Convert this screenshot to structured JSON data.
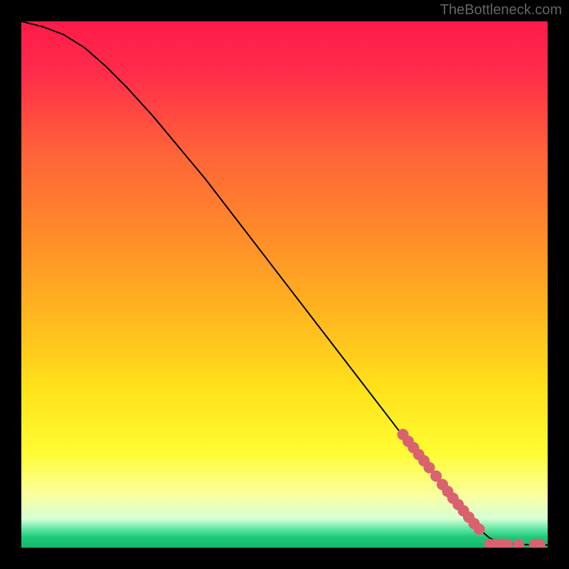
{
  "watermark": "TheBottleneck.com",
  "chart_data": {
    "type": "line",
    "title": "",
    "xlabel": "",
    "ylabel": "",
    "xlim": [
      0,
      100
    ],
    "ylim": [
      0,
      100
    ],
    "gradient_stops": [
      {
        "offset": 0,
        "color": "#ff1a4a"
      },
      {
        "offset": 0.1,
        "color": "#ff2d4a"
      },
      {
        "offset": 0.25,
        "color": "#ff6338"
      },
      {
        "offset": 0.4,
        "color": "#ff8a2a"
      },
      {
        "offset": 0.55,
        "color": "#ffb41f"
      },
      {
        "offset": 0.7,
        "color": "#ffe21a"
      },
      {
        "offset": 0.82,
        "color": "#fffc33"
      },
      {
        "offset": 0.9,
        "color": "#fbffa0"
      },
      {
        "offset": 0.945,
        "color": "#d6ffd6"
      },
      {
        "offset": 0.965,
        "color": "#5de6a3"
      },
      {
        "offset": 0.98,
        "color": "#1ec97a"
      },
      {
        "offset": 1.0,
        "color": "#13b86b"
      }
    ],
    "curve": [
      {
        "x": 0,
        "y": 100
      },
      {
        "x": 4,
        "y": 99
      },
      {
        "x": 8,
        "y": 97.5
      },
      {
        "x": 12,
        "y": 95
      },
      {
        "x": 16,
        "y": 91.5
      },
      {
        "x": 20,
        "y": 87.5
      },
      {
        "x": 25,
        "y": 82
      },
      {
        "x": 30,
        "y": 76
      },
      {
        "x": 35,
        "y": 70
      },
      {
        "x": 40,
        "y": 63.5
      },
      {
        "x": 45,
        "y": 57
      },
      {
        "x": 50,
        "y": 50.5
      },
      {
        "x": 55,
        "y": 44
      },
      {
        "x": 60,
        "y": 37.5
      },
      {
        "x": 65,
        "y": 31
      },
      {
        "x": 70,
        "y": 24.5
      },
      {
        "x": 75,
        "y": 18
      },
      {
        "x": 80,
        "y": 12
      },
      {
        "x": 84,
        "y": 7
      },
      {
        "x": 87,
        "y": 3.5
      },
      {
        "x": 89,
        "y": 1.8
      },
      {
        "x": 91,
        "y": 0.9
      },
      {
        "x": 94,
        "y": 0.6
      },
      {
        "x": 100,
        "y": 0.5
      }
    ],
    "markers": [
      {
        "x": 72.5,
        "y": 21.5
      },
      {
        "x": 73.5,
        "y": 20.2
      },
      {
        "x": 74.5,
        "y": 19.0
      },
      {
        "x": 75.5,
        "y": 17.7
      },
      {
        "x": 76.5,
        "y": 16.5
      },
      {
        "x": 77.5,
        "y": 15.2
      },
      {
        "x": 78.8,
        "y": 13.6
      },
      {
        "x": 80.0,
        "y": 12.0
      },
      {
        "x": 81.0,
        "y": 10.7
      },
      {
        "x": 82.0,
        "y": 9.4
      },
      {
        "x": 83.0,
        "y": 8.2
      },
      {
        "x": 84.0,
        "y": 7.0
      },
      {
        "x": 85.0,
        "y": 5.8
      },
      {
        "x": 86.0,
        "y": 4.6
      },
      {
        "x": 87.0,
        "y": 3.5
      },
      {
        "x": 89.0,
        "y": 0.6
      },
      {
        "x": 90.0,
        "y": 0.6
      },
      {
        "x": 90.8,
        "y": 0.6
      },
      {
        "x": 91.5,
        "y": 0.6
      },
      {
        "x": 92.3,
        "y": 0.6
      },
      {
        "x": 94.5,
        "y": 0.6
      },
      {
        "x": 97.5,
        "y": 0.6
      },
      {
        "x": 98.5,
        "y": 0.6
      }
    ],
    "marker_color": "#d8636f",
    "marker_radius": 8
  }
}
